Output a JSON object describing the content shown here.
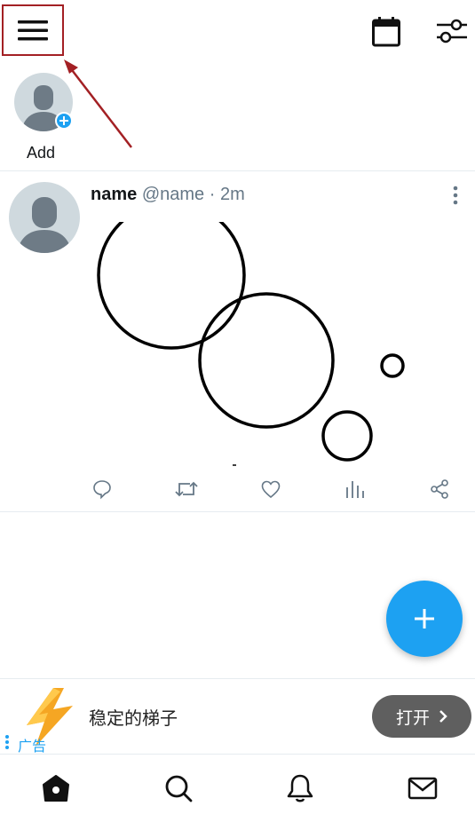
{
  "stories": {
    "add_label": "Add"
  },
  "tweet": {
    "name": "name",
    "handle": "@name",
    "separator": "·",
    "time": "2m"
  },
  "ad": {
    "title": "稳定的梯子",
    "tag": "广告",
    "button_label": "打开"
  },
  "colors": {
    "accent": "#1da1f2",
    "annotation": "#a32024",
    "ad_button": "#5f5f5f",
    "icon_gray": "#657786"
  },
  "icons": {
    "menu": "hamburger-menu-icon",
    "calendar": "calendar-icon",
    "filter": "sliders-icon",
    "reply": "reply-bubble-icon",
    "retweet": "retweet-icon",
    "like": "heart-icon",
    "stats": "bar-chart-icon",
    "share": "share-nodes-icon",
    "compose": "plus-icon",
    "home": "home-icon",
    "search": "search-icon",
    "notifications": "bell-icon",
    "messages": "mail-icon"
  }
}
